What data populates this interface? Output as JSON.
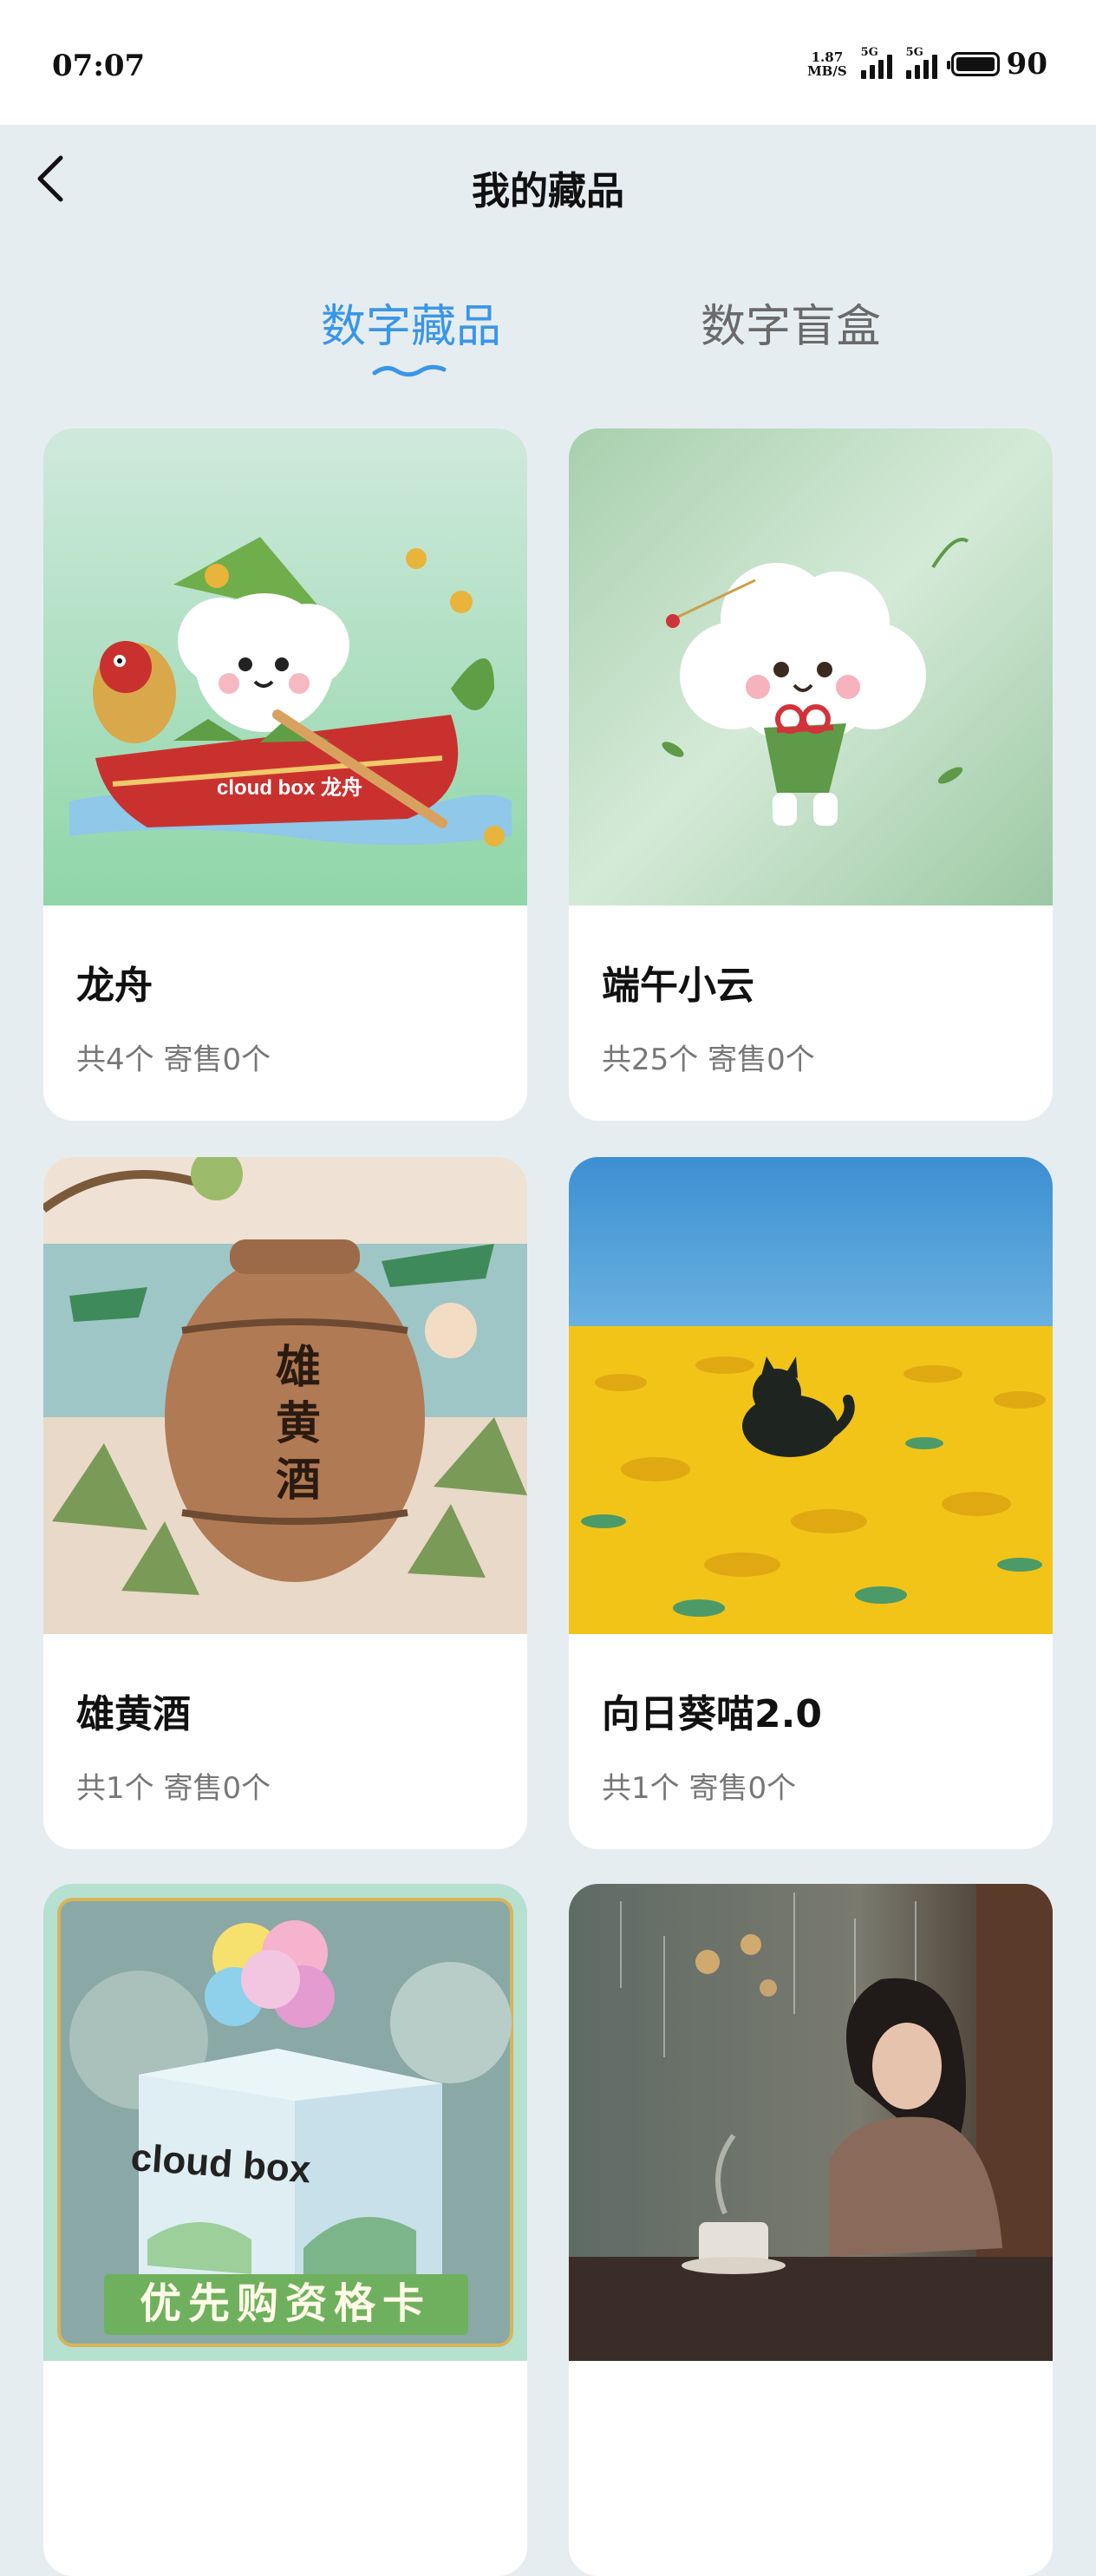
{
  "status_bar": {
    "time": "07:07",
    "net_speed_value": "1.87",
    "net_speed_unit": "MB/S",
    "signal_1_label": "5G",
    "signal_2_label": "5G",
    "battery_level": "90"
  },
  "header": {
    "title": "我的藏品"
  },
  "tabs": [
    {
      "label": "数字藏品",
      "active": true
    },
    {
      "label": "数字盲盒",
      "active": false
    }
  ],
  "accent_color": "#3a96e6",
  "collection": [
    {
      "name": "龙舟",
      "stats": "共4个 寄售0个"
    },
    {
      "name": "端午小云",
      "stats": "共25个 寄售0个"
    },
    {
      "name": "雄黄酒",
      "stats": "共1个 寄售0个"
    },
    {
      "name": "向日葵喵2.0",
      "stats": "共1个 寄售0个"
    },
    {
      "name": "",
      "stats": "",
      "image_text_brand": "cloud box",
      "image_text_banner": "优先购资格卡"
    },
    {
      "name": "",
      "stats": ""
    }
  ],
  "image_texts": {
    "dragon_boat_brand": "cloud box 龙舟",
    "jar_label": [
      "雄",
      "黄",
      "酒"
    ]
  }
}
